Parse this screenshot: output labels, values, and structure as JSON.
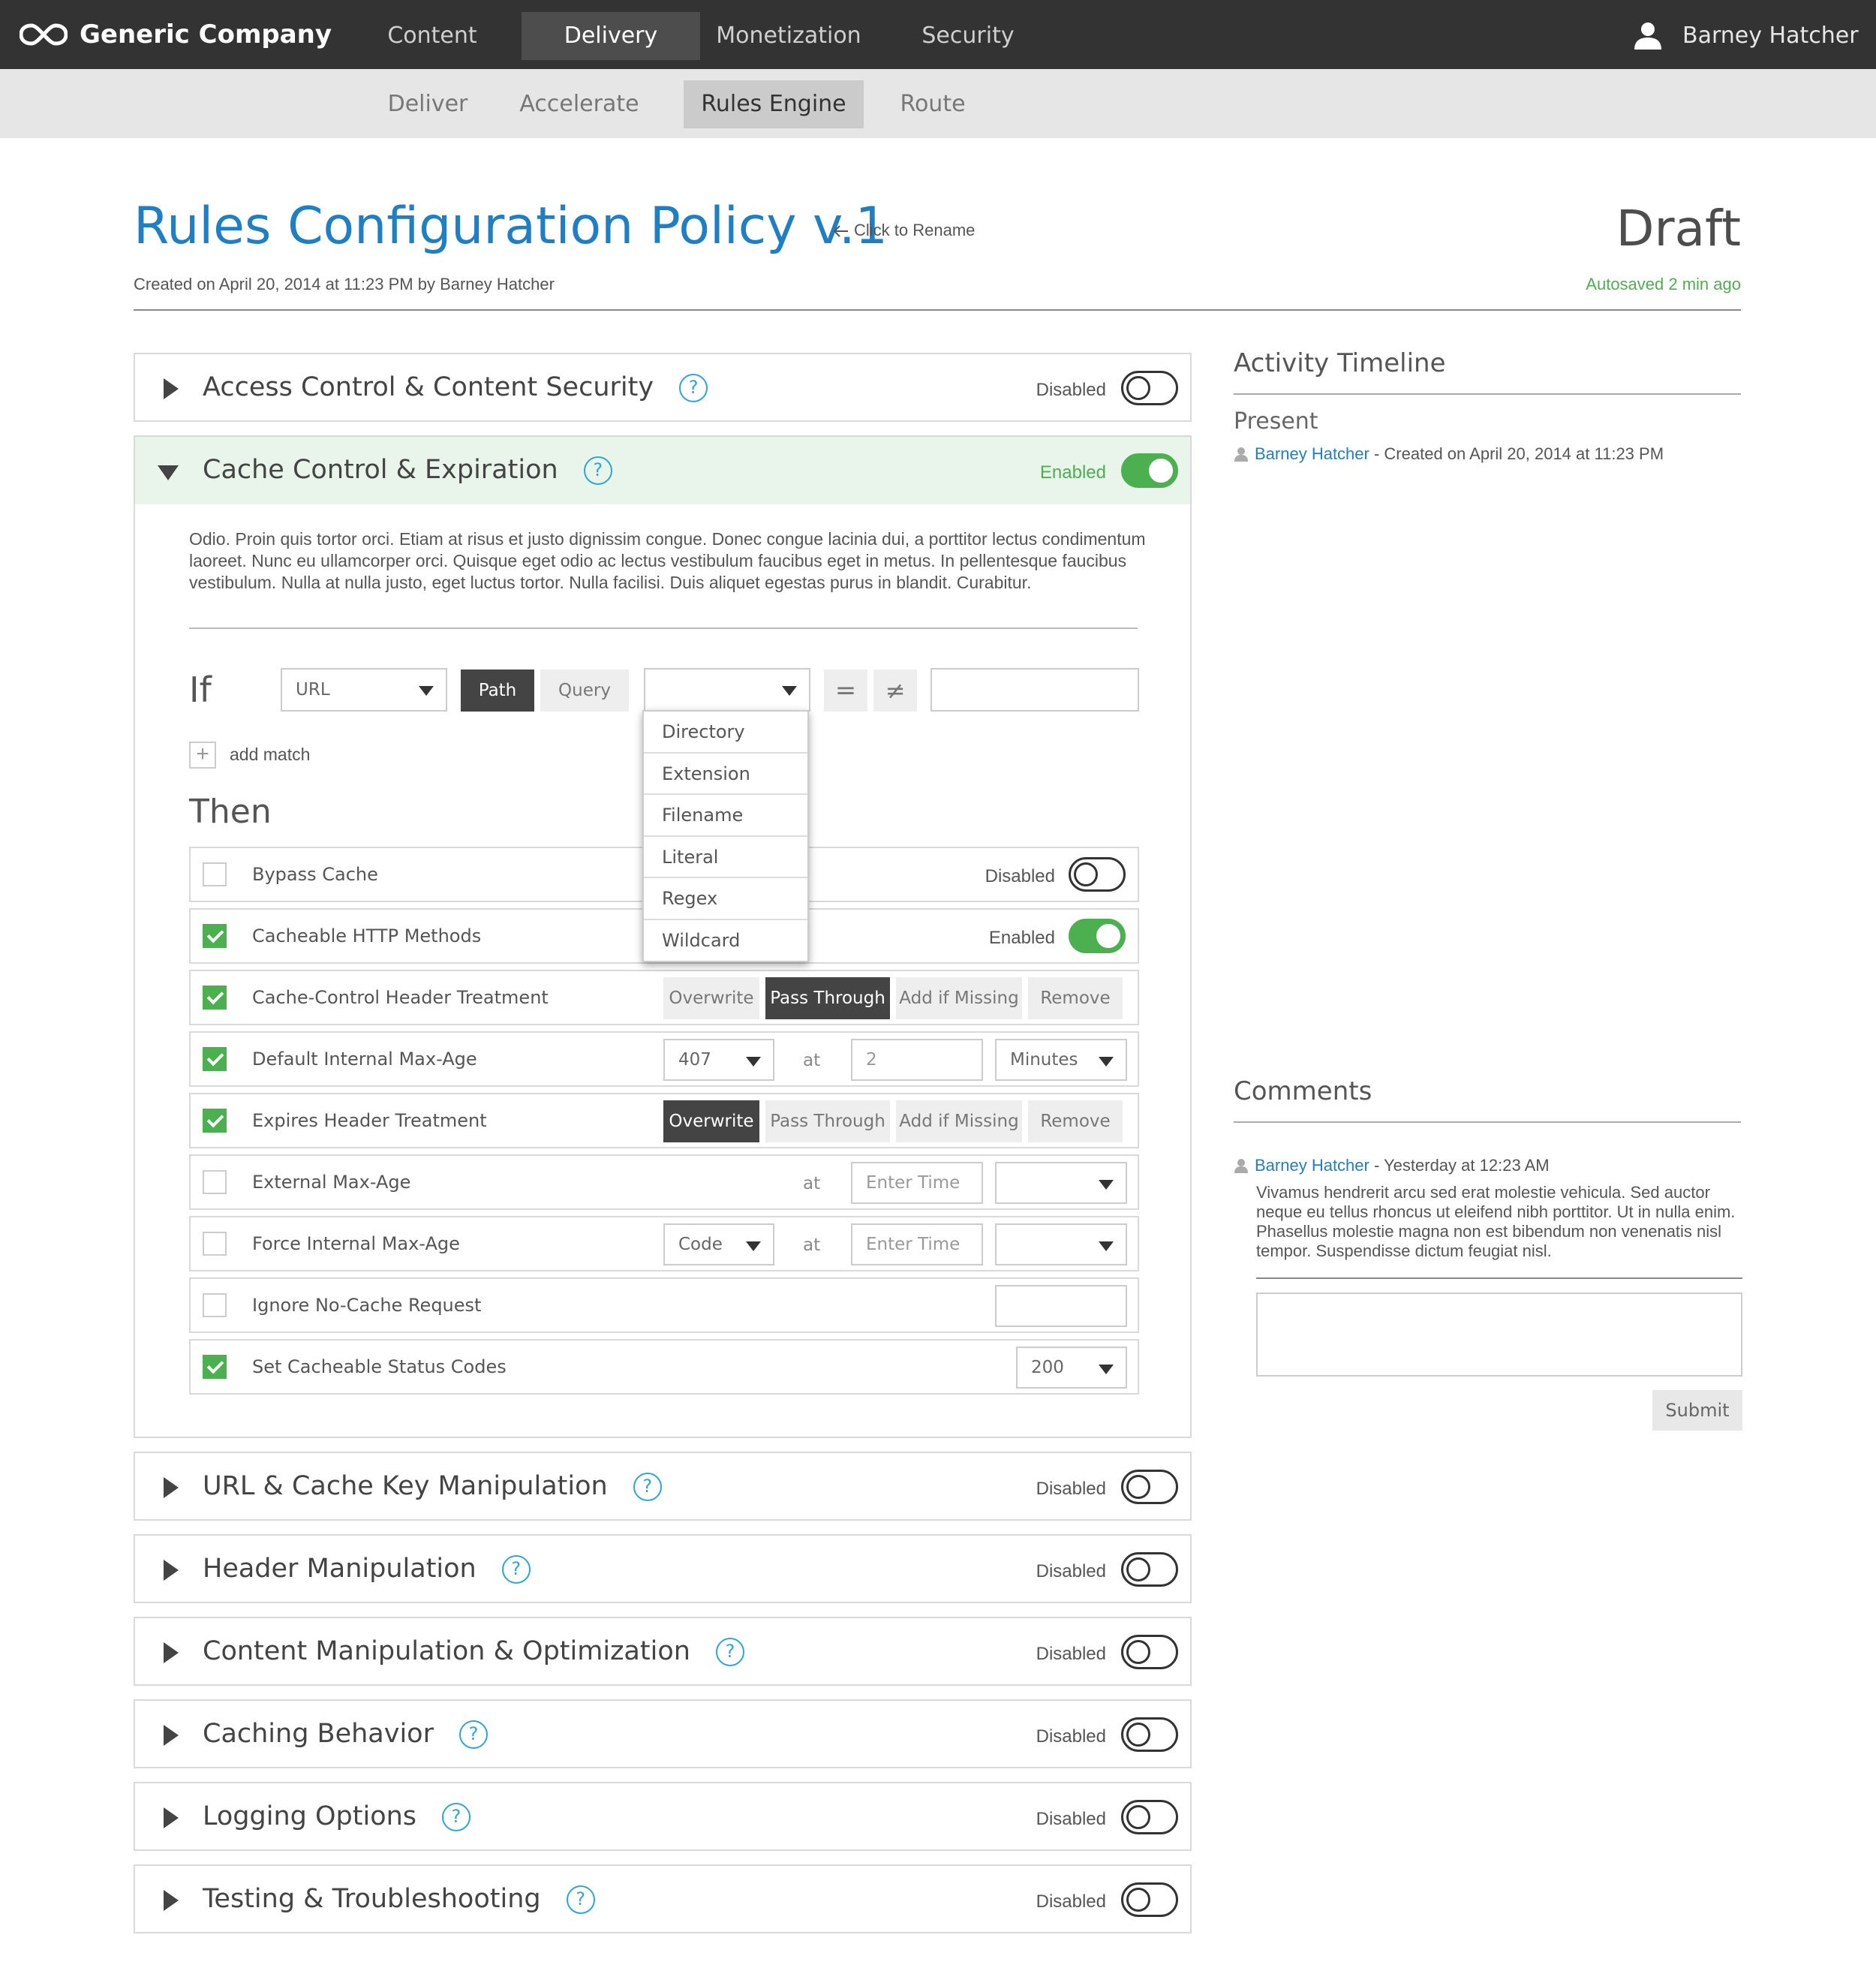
{
  "app": {
    "brand": "Generic Company",
    "user": "Barney Hatcher"
  },
  "nav": {
    "top": [
      "Content",
      "Delivery",
      "Monetization",
      "Security"
    ],
    "top_active": "Delivery",
    "sub": [
      "Deliver",
      "Accelerate",
      "Rules Engine",
      "Route"
    ],
    "sub_active": "Rules Engine"
  },
  "header": {
    "title": "Rules Configuration Policy v.1",
    "rename": "Click to Rename",
    "created": "Created on April 20, 2014 at 11:23 PM by Barney Hatcher",
    "status": "Draft",
    "autosaved": "Autosaved 2 min ago"
  },
  "sections": [
    {
      "title": "Access Control & Content Security",
      "state": "Disabled",
      "enabled": false
    },
    {
      "title": "Cache Control & Expiration",
      "state": "Enabled",
      "enabled": true
    },
    {
      "title": "URL & Cache Key Manipulation",
      "state": "Disabled",
      "enabled": false
    },
    {
      "title": "Header Manipulation",
      "state": "Disabled",
      "enabled": false
    },
    {
      "title": "Content Manipulation & Optimization",
      "state": "Disabled",
      "enabled": false
    },
    {
      "title": "Caching Behavior",
      "state": "Disabled",
      "enabled": false
    },
    {
      "title": "Logging Options",
      "state": "Disabled",
      "enabled": false
    },
    {
      "title": "Testing & Troubleshooting",
      "state": "Disabled",
      "enabled": false
    }
  ],
  "help_glyph": "?",
  "cache_control": {
    "description": "Odio. Proin quis tortor orci. Etiam at risus et justo dignissim congue. Donec congue lacinia dui, a porttitor lectus condimentum laoreet. Nunc eu ullamcorper orci. Quisque eget odio ac lectus vestibulum faucibus eget in metus. In pellentesque faucibus vestibulum. Nulla at nulla justo, eget luctus tortor. Nulla facilisi. Duis aliquet egestas purus in blandit. Curabitur.",
    "if_label": "If",
    "match_field": "URL",
    "match_modes": [
      "Path",
      "Query"
    ],
    "match_mode_active": "Path",
    "match_type": "",
    "equals": "=",
    "not_equals": "≠",
    "match_value": "",
    "add_match": "add match",
    "add_glyph": "+",
    "then_label": "Then",
    "match_type_options": [
      "Directory",
      "Extension",
      "Filename",
      "Literal",
      "Regex",
      "Wildcard"
    ],
    "at_label": "at",
    "rules": [
      {
        "label": "Bypass Cache",
        "checked": false,
        "state": "Disabled",
        "enabled": false
      },
      {
        "label": "Cacheable HTTP Methods",
        "checked": true,
        "state": "Enabled",
        "enabled": true
      },
      {
        "label": "Cache-Control Header Treatment",
        "checked": true,
        "options": [
          "Overwrite",
          "Pass Through",
          "Add if Missing",
          "Remove"
        ],
        "active": "Pass Through"
      },
      {
        "label": "Default Internal Max-Age",
        "checked": true,
        "select": "407",
        "value": "2",
        "unit": "Minutes"
      },
      {
        "label": "Expires Header Treatment",
        "checked": true,
        "options": [
          "Overwrite",
          "Pass Through",
          "Add if Missing",
          "Remove"
        ],
        "active": "Overwrite"
      },
      {
        "label": "External Max-Age",
        "checked": false,
        "placeholder": "Enter Time",
        "unit": ""
      },
      {
        "label": "Force Internal Max-Age",
        "checked": false,
        "select": "Code",
        "placeholder": "Enter Time",
        "unit": ""
      },
      {
        "label": "Ignore No-Cache Request",
        "checked": false,
        "value": ""
      },
      {
        "label": "Set Cacheable Status Codes",
        "checked": true,
        "select": "200"
      }
    ]
  },
  "activity": {
    "title": "Activity Timeline",
    "period": "Present",
    "entry_user": "Barney Hatcher",
    "entry_text": " - Created on April 20, 2014 at 11:23 PM"
  },
  "comments": {
    "title": "Comments",
    "user": "Barney Hatcher",
    "time": " - Yesterday at 12:23 AM",
    "text": "Vivamus hendrerit arcu sed erat molestie vehicula. Sed auctor neque eu tellus rhoncus ut eleifend nibh porttitor. Ut in nulla enim. Phasellus molestie magna non est bibendum non venenatis nisl tempor. Suspendisse dictum feugiat nisl.",
    "input_value": "",
    "submit_label": "Submit"
  },
  "colors": {
    "accent": "#1f7fc4",
    "enabled_green": "#4caf50",
    "help_blue": "#2aa7d6",
    "topbar": "#333333"
  }
}
